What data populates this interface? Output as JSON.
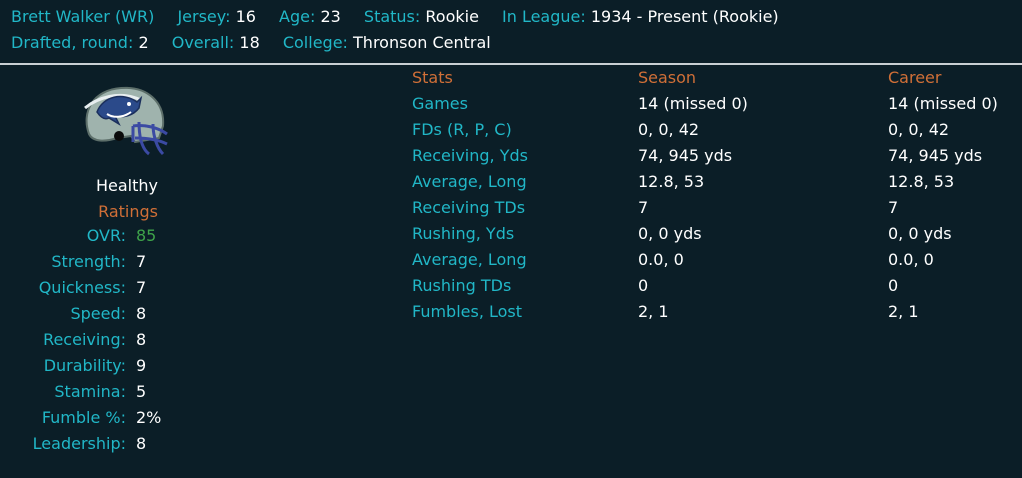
{
  "header": {
    "name": "Brett Walker",
    "position": "(WR)",
    "jersey_label": "Jersey:",
    "jersey": "16",
    "age_label": "Age:",
    "age": "23",
    "status_label": "Status:",
    "status": "Rookie",
    "league_label": "In League:",
    "league": "1934 - Present (Rookie)",
    "drafted_label": "Drafted, round:",
    "drafted": "2",
    "overall_label": "Overall:",
    "overall": "18",
    "college_label": "College:",
    "college": "Thronson Central"
  },
  "helmet": {
    "icon": "shark-helmet-icon",
    "shell_color": "#9fb3ad",
    "mask_color": "#3b4aa3"
  },
  "health": "Healthy",
  "ratings": {
    "title": "Ratings",
    "items": [
      {
        "label": "OVR:",
        "value": "85"
      },
      {
        "label": "Strength:",
        "value": "7"
      },
      {
        "label": "Quickness:",
        "value": "7"
      },
      {
        "label": "Speed:",
        "value": "8"
      },
      {
        "label": "Receiving:",
        "value": "8"
      },
      {
        "label": "Durability:",
        "value": "9"
      },
      {
        "label": "Stamina:",
        "value": "5"
      },
      {
        "label": "Fumble %:",
        "value": "2%"
      },
      {
        "label": "Leadership:",
        "value": "8"
      }
    ]
  },
  "stats": {
    "headers": {
      "name": "Stats",
      "season": "Season",
      "career": "Career"
    },
    "rows": [
      {
        "name": "Games",
        "season": "14 (missed 0)",
        "career": "14 (missed 0)"
      },
      {
        "name": "FDs (R, P, C)",
        "season": "0, 0, 42",
        "career": "0, 0, 42"
      },
      {
        "name": "Receiving, Yds",
        "season": "74, 945 yds",
        "career": "74, 945 yds"
      },
      {
        "name": "Average, Long",
        "season": "12.8, 53",
        "career": "12.8, 53"
      },
      {
        "name": "Receiving TDs",
        "season": "7",
        "career": "7"
      },
      {
        "name": "Rushing, Yds",
        "season": "0, 0 yds",
        "career": "0, 0 yds"
      },
      {
        "name": "Average, Long",
        "season": "0.0, 0",
        "career": "0.0, 0"
      },
      {
        "name": "Rushing TDs",
        "season": "0",
        "career": "0"
      },
      {
        "name": "Fumbles, Lost",
        "season": "2, 1",
        "career": "2, 1"
      }
    ]
  },
  "colors": {
    "background": "#0b1e27",
    "label_cyan": "#21b7c7",
    "header_orange": "#d06f37",
    "ovr_green": "#3ea34a",
    "divider": "#c9cfd3"
  }
}
